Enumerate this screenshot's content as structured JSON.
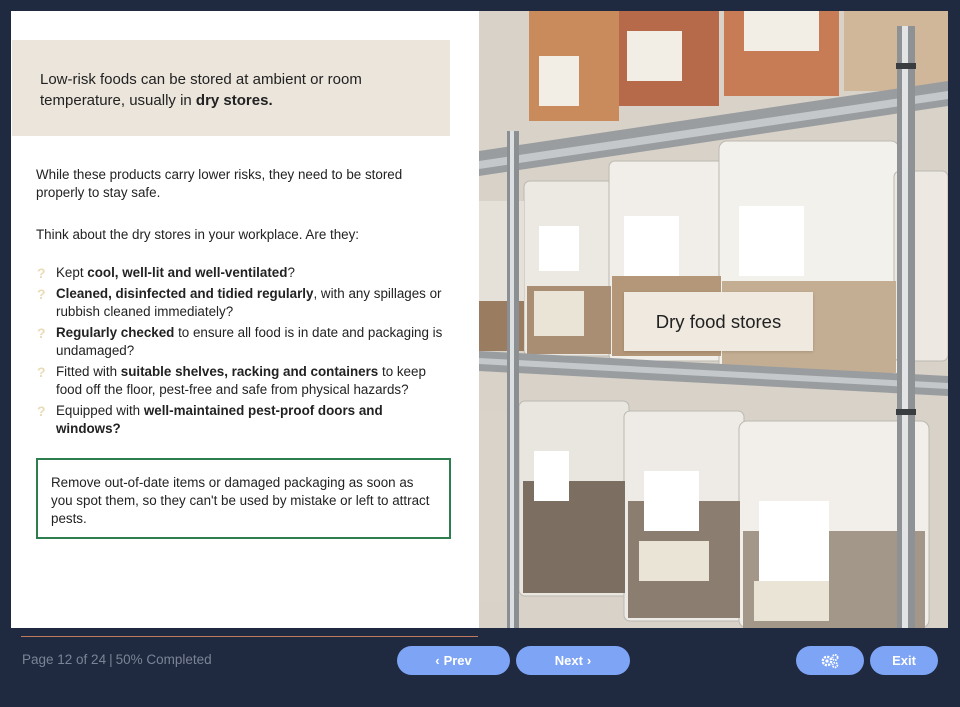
{
  "callout": {
    "text_before": "Low-risk foods can be stored at ambient or room temperature, usually in ",
    "text_bold": "dry stores."
  },
  "intro": {
    "p1": "While these products carry lower risks, they need to be stored properly to stay safe.",
    "p2": "Think about the dry stores in your workplace. Are they:"
  },
  "checklist": {
    "marker": "?",
    "items": [
      {
        "pre": "Kept ",
        "bold": "cool, well-lit and well-ventilated",
        "post": "?"
      },
      {
        "pre": "",
        "bold": "Cleaned, disinfected and tidied regularly",
        "post": ", with any spillages or rubbish cleaned immediately?"
      },
      {
        "pre": "",
        "bold": "Regularly checked",
        "post": " to ensure all food is in date and packaging is undamaged?"
      },
      {
        "pre": "Fitted with ",
        "bold": "suitable shelves, racking and containers",
        "post": " to keep food off the floor, pest-free and safe from physical hazards?"
      },
      {
        "pre": "Equipped with ",
        "bold": "well-maintained pest-proof doors and windows?",
        "post": ""
      }
    ]
  },
  "tip": {
    "text": "Remove out-of-date items or damaged packaging as soon as you spot them, so they can't be used by mistake or left to attract pests."
  },
  "photo": {
    "label": "Dry food stores"
  },
  "footer": {
    "page_text": "Page 12 of 24",
    "separator": "|",
    "progress_text": "50% Completed",
    "progress_value": 0.5,
    "prev_label": "Prev",
    "next_label": "Next",
    "exit_label": "Exit",
    "settings_icon": "gears-icon"
  },
  "colors": {
    "background": "#1f2940",
    "button": "#7ea4f5",
    "callout_bg": "#ebe5dc",
    "tip_border": "#2e7d4f",
    "progress_line": "#c07a5b"
  }
}
